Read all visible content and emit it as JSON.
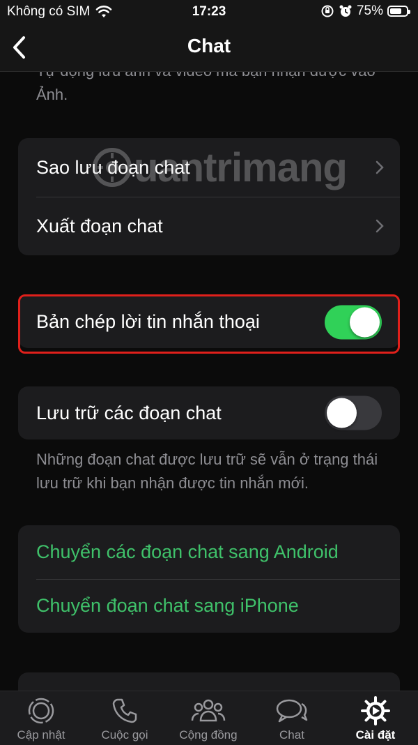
{
  "status_bar": {
    "carrier": "Không có SIM",
    "time": "17:23",
    "battery": "75%",
    "battery_level": 0.75
  },
  "nav": {
    "title": "Chat",
    "back_icon": "chevron-left-icon"
  },
  "content": {
    "top_footer": "Tự động lưu ảnh và video mà bạn nhận được vào Ảnh.",
    "chat_actions": {
      "backup": "Sao lưu đoạn chat",
      "export": "Xuất đoạn chat"
    },
    "voice_transcripts": {
      "label": "Bản chép lời tin nhắn thoại",
      "enabled": true
    },
    "archive": {
      "label": "Lưu trữ các đoạn chat",
      "enabled": false,
      "footer": "Những đoạn chat được lưu trữ sẽ vẫn ở trạng thái lưu trữ khi bạn nhận được tin nhắn mới."
    },
    "transfer": {
      "to_android": "Chuyển các đoạn chat sang Android",
      "to_iphone": "Chuyển đoạn chat sang iPhone"
    },
    "watermark": "uantrimang"
  },
  "tabs": [
    {
      "label": "Cập nhật",
      "icon": "updates-icon",
      "active": false
    },
    {
      "label": "Cuộc gọi",
      "icon": "phone-icon",
      "active": false
    },
    {
      "label": "Cộng đồng",
      "icon": "community-icon",
      "active": false
    },
    {
      "label": "Chat",
      "icon": "chat-icon",
      "active": false
    },
    {
      "label": "Cài đặt",
      "icon": "gear-icon",
      "active": true
    }
  ],
  "colors": {
    "accent_green": "#3fc16a",
    "toggle_on": "#30d158",
    "highlight_border": "#e0201b"
  }
}
